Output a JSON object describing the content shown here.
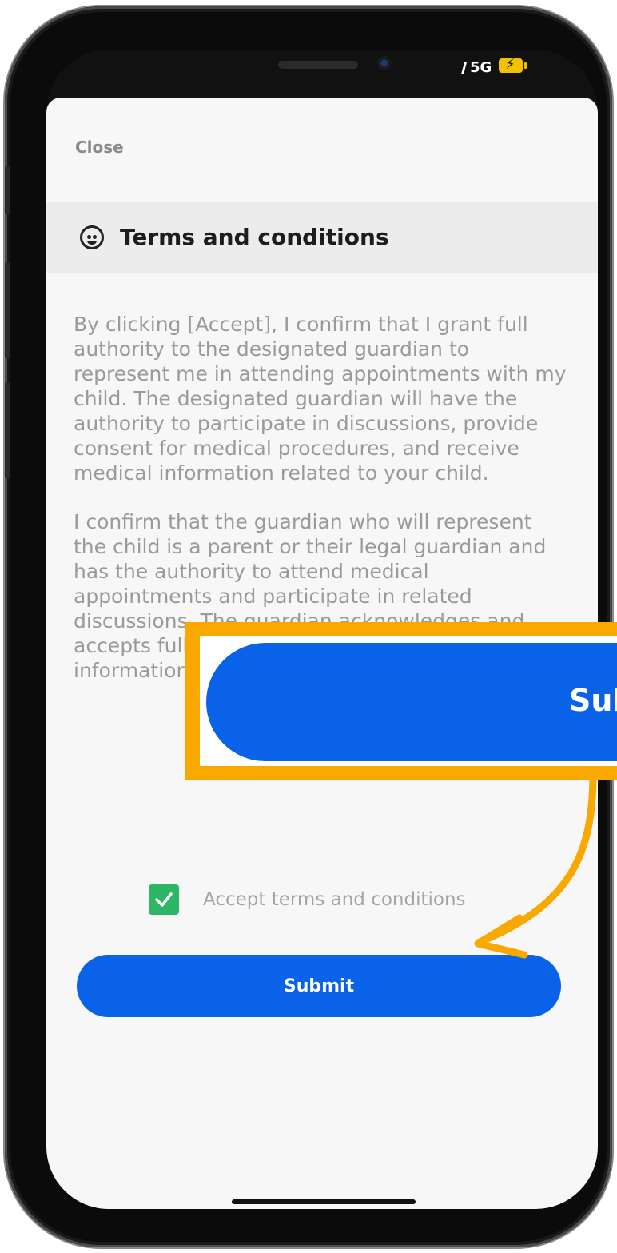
{
  "status_bar": {
    "network": "5G"
  },
  "sheet": {
    "close_label": "Close",
    "title": "Terms and conditions",
    "paragraphs": [
      "By clicking [Accept], I confirm that I grant full authority to the designated guardian to represent me in attending appointments with my child. The designated guardian will have the authority to participate in discussions, provide consent for medical procedures, and receive medical information related to your child.",
      "I confirm that the guardian who will represent the child is a parent or their legal guardian and has the authority to attend medical appointments and participate in related discussions. The guardian acknowledges and accepts full responsibility for the decisions and information provided during these appointments."
    ],
    "accept": {
      "label": "Accept terms and conditions",
      "checked": true
    },
    "submit_label": "Submit"
  },
  "callout": {
    "label": "Submit",
    "color": "#f9a800"
  },
  "colors": {
    "primary": "#0962e8",
    "checkbox": "#2db665",
    "highlight": "#f9a800"
  }
}
